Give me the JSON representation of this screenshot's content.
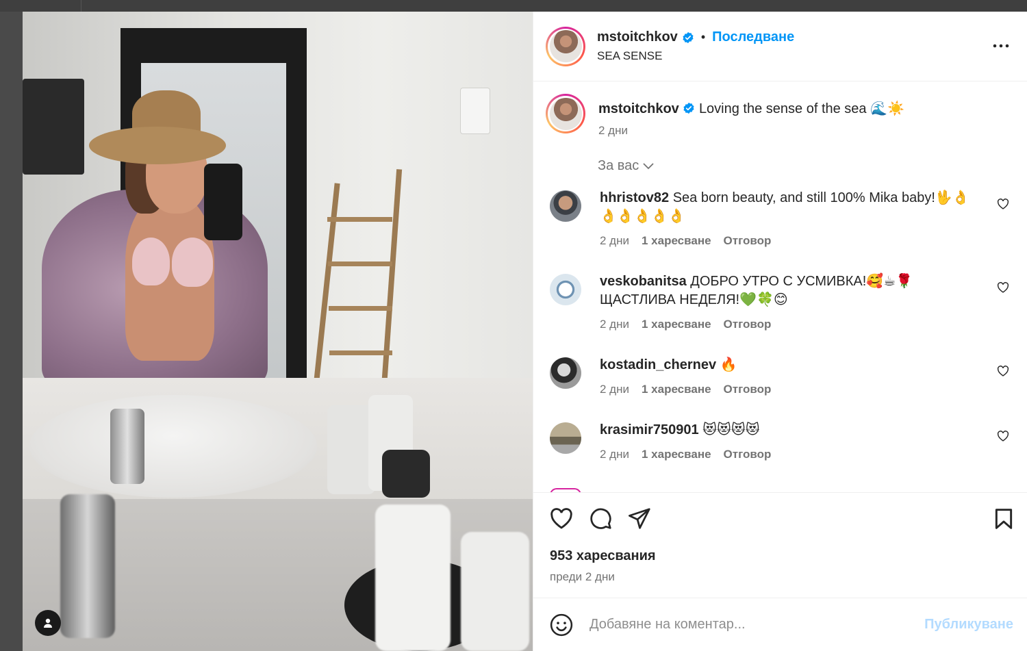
{
  "post": {
    "username": "mstoitchkov",
    "follow_label": "Последване",
    "location": "SEA SENSE",
    "caption_text": "Loving the sense of the sea 🌊☀️",
    "caption_time": "2 дни",
    "for_you_label": "За вас",
    "likes_count": "953 харесвания",
    "posted_ago": "преди 2 дни"
  },
  "comments": [
    {
      "username": "hhristov82",
      "text": "Sea born beauty, and still 100% Mika baby!🖖👌👌👌👌👌👌",
      "time": "2 дни",
      "likes": "1 харесване",
      "reply": "Отговор",
      "avatar_color": "#6b6f75"
    },
    {
      "username": "veskobanitsa",
      "text": "ДОБРО УТРО С УСМИВКА!🥰☕🌹 ЩАСТЛИВА НЕДЕЛЯ!💚🍀😊",
      "time": "2 дни",
      "likes": "1 харесване",
      "reply": "Отговор",
      "avatar_color": "#9fb6c9"
    },
    {
      "username": "kostadin_chernev",
      "text": "🔥",
      "time": "2 дни",
      "likes": "1 харесване",
      "reply": "Отговор",
      "avatar_color": "#4a4a4a"
    },
    {
      "username": "krasimir750901",
      "text": "😻😻😻😻",
      "time": "2 дни",
      "likes": "1 харесване",
      "reply": "Отговор",
      "avatar_color": "#8c8470"
    }
  ],
  "composer": {
    "placeholder": "Добавяне на коментар...",
    "post_label": "Публикуване"
  },
  "icons": {
    "more": "more-horizontal-icon",
    "like": "heart-icon",
    "comment": "comment-bubble-icon",
    "share": "paper-plane-icon",
    "save": "bookmark-icon",
    "emoji": "smiley-icon",
    "tagged_users": "user-icon",
    "verified": "verified-badge-icon",
    "chevron": "chevron-down-icon"
  },
  "colors": {
    "accent": "#0095f6",
    "verified": "#0095f6",
    "post_disabled": "#b3dbff",
    "text_primary": "#262626",
    "text_secondary": "#737373"
  }
}
